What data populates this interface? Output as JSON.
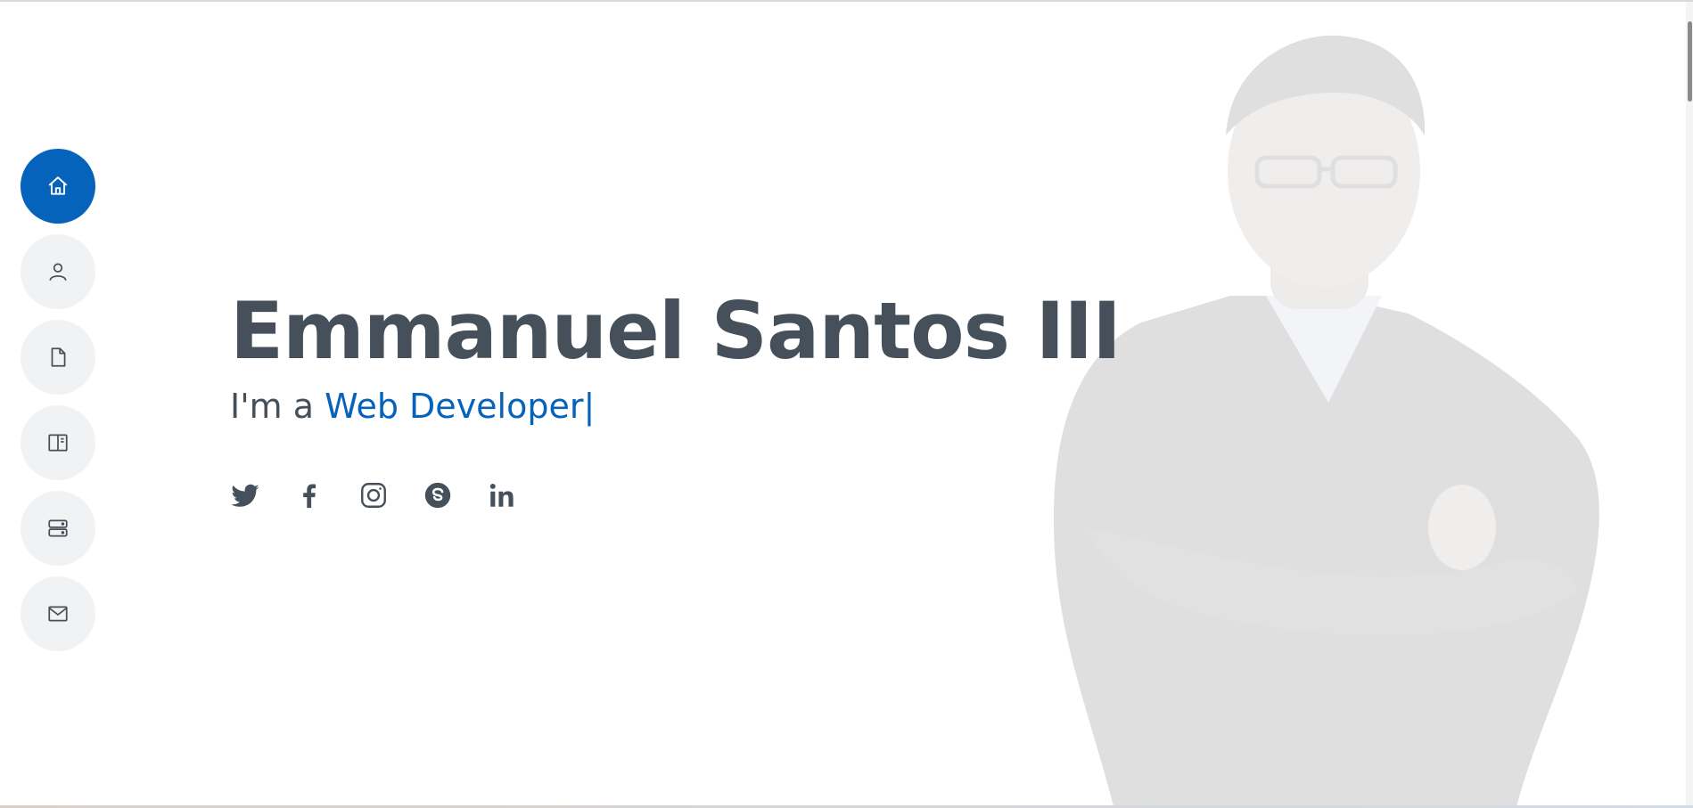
{
  "hero": {
    "name": "Emmanuel Santos III",
    "intro": "I'm a ",
    "role": "Web Developer",
    "cursor": "|"
  },
  "nav": [
    {
      "icon": "home-icon",
      "active": true
    },
    {
      "icon": "person-icon",
      "active": false
    },
    {
      "icon": "file-icon",
      "active": false
    },
    {
      "icon": "book-half-icon",
      "active": false
    },
    {
      "icon": "server-icon",
      "active": false
    },
    {
      "icon": "envelope-icon",
      "active": false
    }
  ],
  "social": [
    "twitter-icon",
    "facebook-icon",
    "instagram-icon",
    "skype-icon",
    "linkedin-icon"
  ],
  "colors": {
    "accent": "#0563bb",
    "text": "#45505b",
    "nav_bg": "#f1f2f3"
  }
}
